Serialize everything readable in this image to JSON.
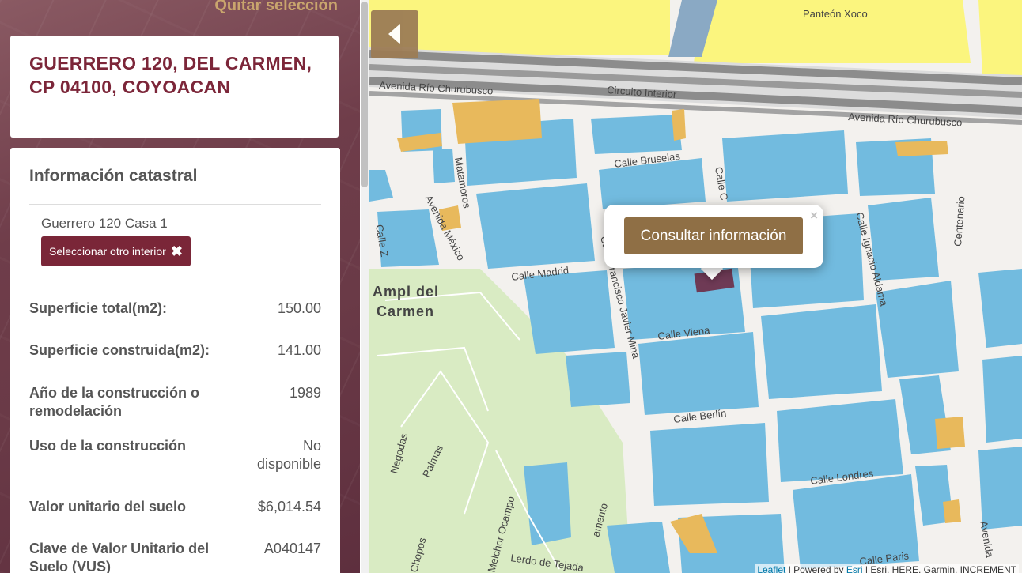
{
  "panel": {
    "clear_selection": "Quitar selección",
    "address": "GUERRERO 120, DEL CARMEN, CP 04100, COYOACAN",
    "info_heading": "Información catastral",
    "interior_name": "Guerrero 120 Casa 1",
    "select_other_label": "Seleccionar otro interior",
    "select_other_icon": "times-icon",
    "rows": [
      {
        "label": "Superficie total(m2):",
        "value": "150.00"
      },
      {
        "label": "Superficie construida(m2):",
        "value": "141.00"
      },
      {
        "label": "Año de la construcción o remodelación",
        "value": "1989"
      },
      {
        "label": "Uso de la construcción",
        "value": "No disponible"
      },
      {
        "label": "Valor unitario del suelo",
        "value": "$6,014.54"
      },
      {
        "label": "Clave de Valor Unitario del Suelo (VUS)",
        "value": "A040147"
      }
    ]
  },
  "map": {
    "back_icon": "chevron-left-icon",
    "popup": {
      "button_label": "Consultar información",
      "close_label": "×"
    },
    "places": {
      "panteon": "Panteón Xoco",
      "ampl_line1": "Ampl del",
      "ampl_line2": "Carmen"
    },
    "streets": {
      "circuito": "Circuito Interior",
      "rio1": "Avenida Río Churubusco",
      "rio2": "Avenida Río Churubusco",
      "bruselas": "Calle Bruselas",
      "madrid": "Calle Madrid",
      "viena": "Calle Viena",
      "berlin": "Calle Berlín",
      "londres": "Calle Londres",
      "paris": "Calle Paris",
      "matamoros": "Matamoros",
      "av_mexico": "Avenida México",
      "javier_mina": "Calle Francisco Javier Mina",
      "aldama": "Calle Ignacio Aldama",
      "centenario": "Centenario",
      "negodas": "Negodas",
      "palmas": "Palmas",
      "chopos": "Chopos",
      "melchor": "Melchor Ocampo",
      "lerdo": "Lerdo de Tejada",
      "calle_c": "Calle C",
      "calle_z": "Calle Z",
      "amento": "amento",
      "avenida_edge": "Avenida"
    },
    "attribution": {
      "leaflet": "Leaflet",
      "sep": " | Powered by ",
      "esri": "Esri",
      "rest": " | Esri, HERE, Garmin, INCREMENT"
    },
    "colors": {
      "building": "#72bbdf",
      "building_orange": "#e8b95c",
      "park": "#d9ebc3",
      "yellow_zone": "#fbf57e",
      "road_major": "#8c8c8c",
      "water": "#8aa9c4",
      "selected_parcel": "#6e3a55"
    }
  }
}
